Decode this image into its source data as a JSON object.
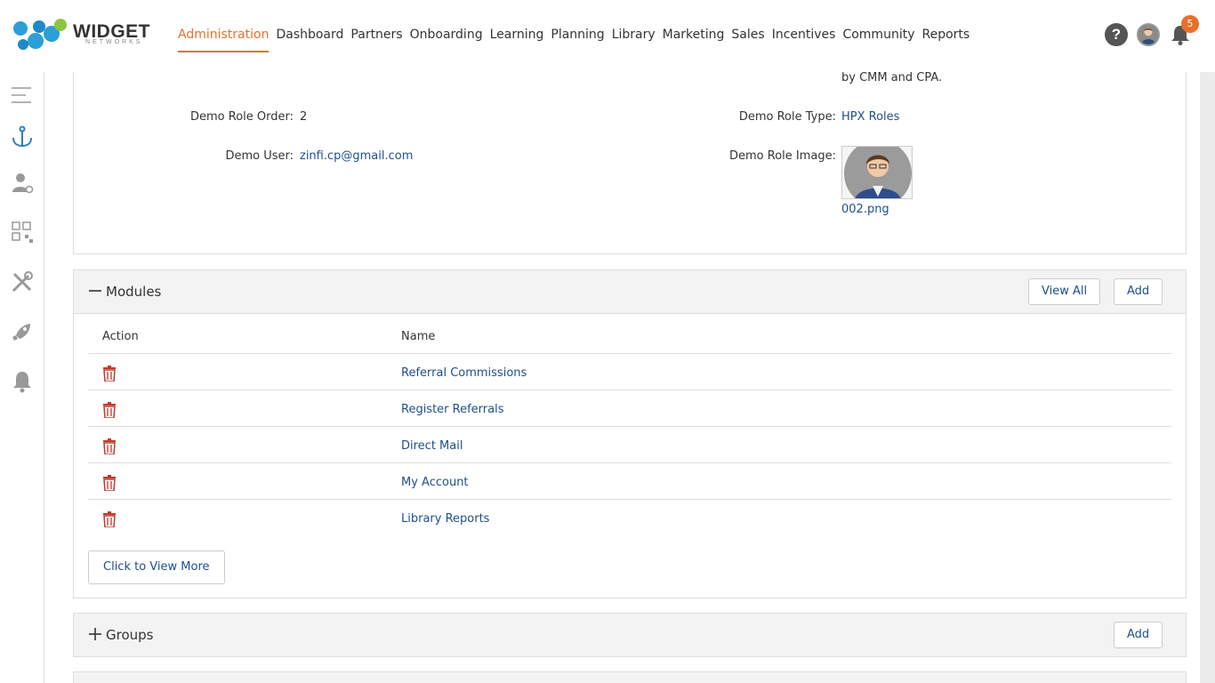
{
  "brand": {
    "name": "WIDGET",
    "sub": "NETWORKS"
  },
  "nav": {
    "items": [
      {
        "label": "Administration",
        "active": true
      },
      {
        "label": "Dashboard"
      },
      {
        "label": "Partners"
      },
      {
        "label": "Onboarding"
      },
      {
        "label": "Learning"
      },
      {
        "label": "Planning"
      },
      {
        "label": "Library"
      },
      {
        "label": "Marketing"
      },
      {
        "label": "Sales"
      },
      {
        "label": "Incentives"
      },
      {
        "label": "Community"
      },
      {
        "label": "Reports"
      }
    ]
  },
  "header": {
    "help_label": "?",
    "notification_count": "5"
  },
  "sidebar": {
    "icons": [
      "menu-icon",
      "anchor-icon",
      "user-settings-icon",
      "qr-grid-icon",
      "tools-icon",
      "rocket-icon",
      "bell-icon"
    ]
  },
  "details": {
    "top_note": "by CMM and CPA.",
    "role_order_label": "Demo Role Order:",
    "role_order_value": "2",
    "role_type_label": "Demo Role Type:",
    "role_type_value": "HPX Roles",
    "user_label": "Demo User:",
    "user_value": "zinfi.cp@gmail.com",
    "image_label": "Demo Role Image:",
    "image_file": "002.png"
  },
  "modules": {
    "title": "Modules",
    "view_all": "View All",
    "add": "Add",
    "col_action": "Action",
    "col_name": "Name",
    "rows": [
      {
        "name": "Referral Commissions"
      },
      {
        "name": "Register Referrals"
      },
      {
        "name": "Direct Mail"
      },
      {
        "name": "My Account"
      },
      {
        "name": "Library Reports"
      }
    ],
    "view_more": "Click to View More"
  },
  "groups": {
    "title": "Groups",
    "add": "Add"
  },
  "colors": {
    "accent": "#e8702a",
    "link": "#1e4e8c",
    "danger": "#c0392b"
  }
}
